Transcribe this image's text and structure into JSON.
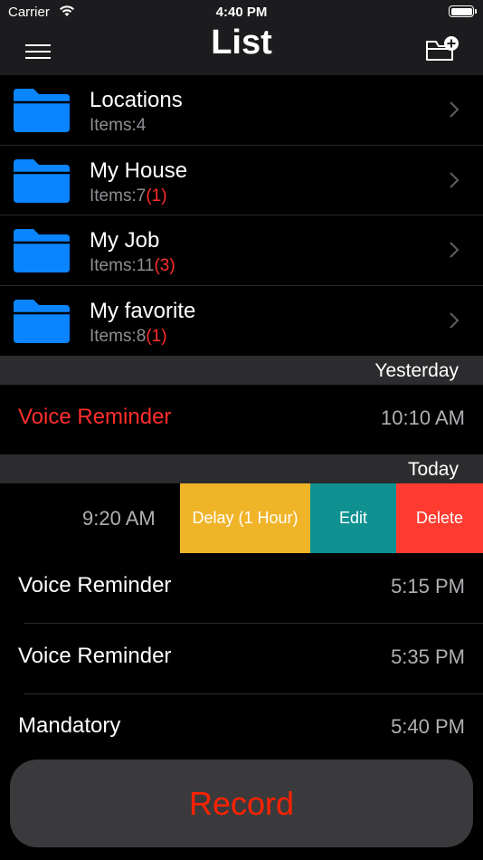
{
  "status": {
    "carrier": "Carrier",
    "time": "4:40 PM"
  },
  "nav": {
    "title": "List"
  },
  "folders": [
    {
      "name": "Locations",
      "count_label": "Items:4",
      "badge": ""
    },
    {
      "name": "My House",
      "count_label": "Items:7",
      "badge": "(1)"
    },
    {
      "name": "My Job",
      "count_label": "Items:11",
      "badge": "(3)"
    },
    {
      "name": "My favorite",
      "count_label": "Items:8",
      "badge": "(1)"
    }
  ],
  "sections": {
    "yesterday": "Yesterday",
    "today": "Today"
  },
  "yesterday_items": [
    {
      "title": "Voice Reminder",
      "time": "10:10 AM",
      "title_color": "#ff2d2d"
    }
  ],
  "today_items": [
    {
      "title": "Voice Reminder",
      "time": "5:15 PM"
    },
    {
      "title": "Voice Reminder",
      "time": "5:35 PM"
    },
    {
      "title": "Mandatory",
      "time": "5:40 PM"
    }
  ],
  "swiped_item": {
    "time": "9:20 AM",
    "actions": {
      "delay": "Delay (1 Hour)",
      "edit": "Edit",
      "delete": "Delete"
    }
  },
  "record": {
    "label": "Record"
  },
  "colors": {
    "folder_blue": "#0a84ff",
    "delay": "#f0b429",
    "edit": "#0e9190",
    "delete": "#ff3b30",
    "record_text": "#ff2200"
  }
}
